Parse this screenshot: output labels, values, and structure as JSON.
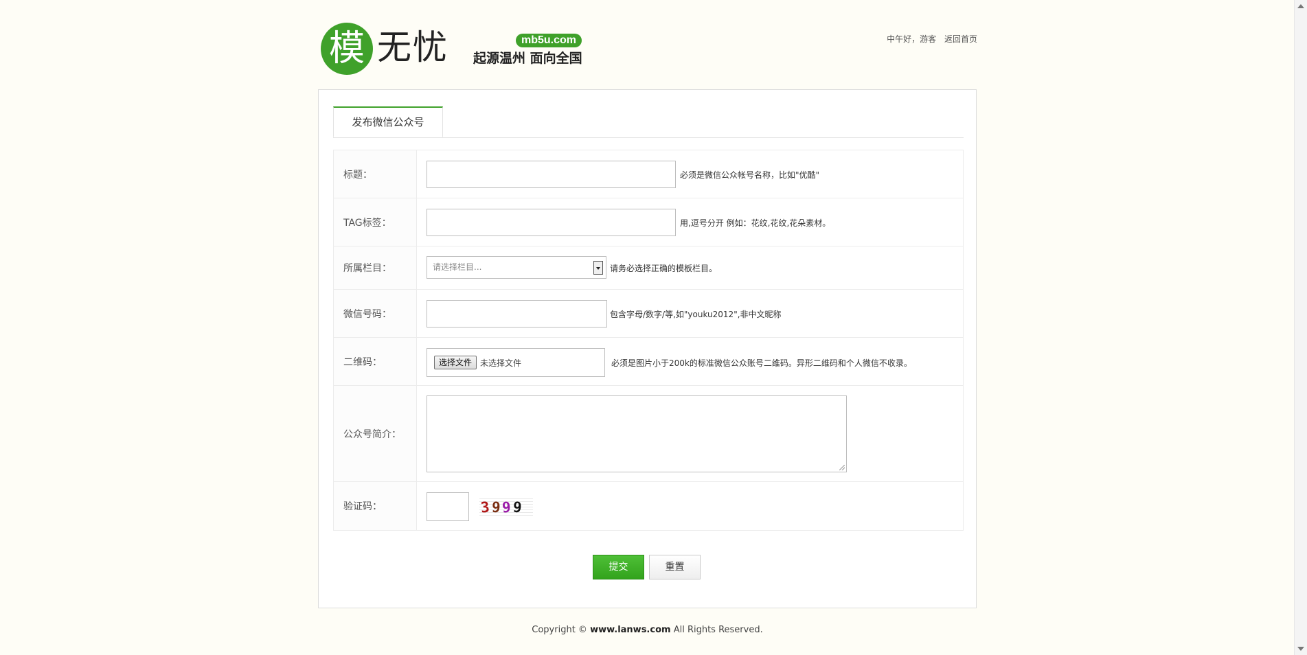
{
  "header": {
    "logo_mark": "模",
    "logo_name": "无忧",
    "logo_domain": "mb5u.com",
    "logo_slogan": "起源温州  面向全国",
    "greeting": "中午好，游客",
    "home_link": "返回首页"
  },
  "tabs": [
    {
      "label": "发布微信公众号",
      "active": true
    }
  ],
  "form": {
    "title_label": "标题：",
    "title_hint": "必须是微信公众帐号名称，比如\"优酷\"",
    "tag_label": "TAG标签：",
    "tag_hint": "用,逗号分开 例如：花纹,花纹,花朵素材。",
    "category_label": "所属栏目：",
    "category_selected": "请选择栏目...",
    "category_hint": "请务必选择正确的模板栏目。",
    "wechat_id_label": "微信号码：",
    "wechat_id_hint": "包含字母/数字/等,如\"youku2012\",非中文昵称",
    "qrcode_label": "二维码：",
    "file_button": "选择文件",
    "file_status": "未选择文件",
    "qrcode_hint": "必须是图片小于200k的标准微信公众账号二维码。异形二维码和个人微信不收录。",
    "intro_label": "公众号简介：",
    "captcha_label": "验证码：",
    "captcha_chars": [
      "3",
      "9",
      "9",
      "9"
    ],
    "captcha_colors": [
      "#b01818",
      "#7a2e12",
      "#9a1ca8",
      "#111111"
    ]
  },
  "buttons": {
    "submit": "提交",
    "reset": "重置"
  },
  "footer": {
    "prefix": "Copyright ©",
    "site": "www.lanws.com",
    "suffix": "All Rights Reserved."
  },
  "colors": {
    "brand_green": "#3fa12a",
    "background": "#fefdf6"
  }
}
